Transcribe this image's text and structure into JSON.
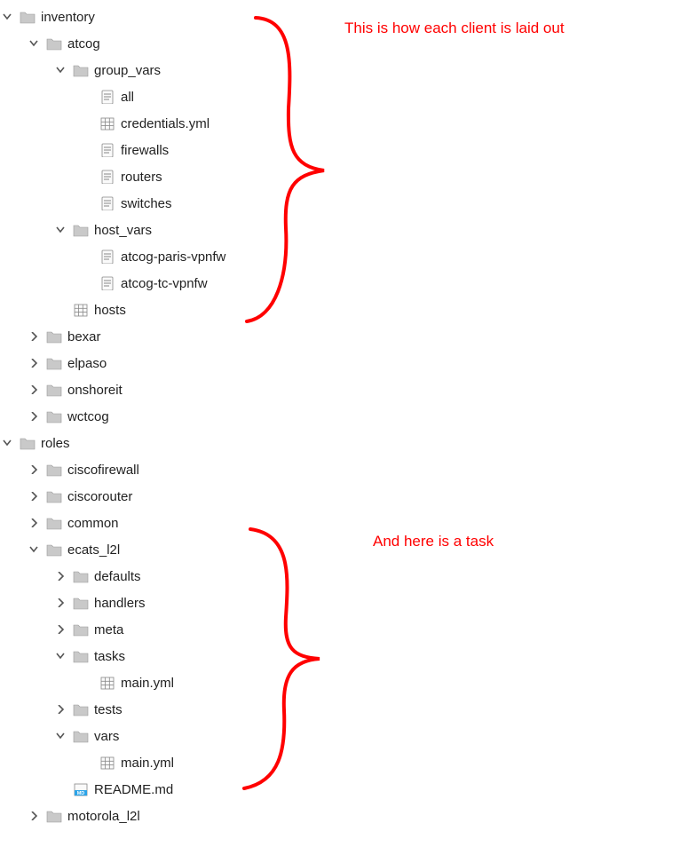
{
  "annotations": {
    "top": "This is how each client is laid out",
    "bottom": "And here is a task"
  },
  "tree": {
    "inventory": {
      "label": "inventory",
      "atcog": {
        "label": "atcog",
        "group_vars": {
          "label": "group_vars",
          "all": "all",
          "credentials": "credentials.yml",
          "firewalls": "firewalls",
          "routers": "routers",
          "switches": "switches"
        },
        "host_vars": {
          "label": "host_vars",
          "paris": "atcog-paris-vpnfw",
          "tc": "atcog-tc-vpnfw"
        },
        "hosts": "hosts"
      },
      "bexar": "bexar",
      "elpaso": "elpaso",
      "onshoreit": "onshoreit",
      "wctcog": "wctcog"
    },
    "roles": {
      "label": "roles",
      "ciscofirewall": "ciscofirewall",
      "ciscorouter": "ciscorouter",
      "common": "common",
      "ecats_l2l": {
        "label": "ecats_l2l",
        "defaults": "defaults",
        "handlers": "handlers",
        "meta": "meta",
        "tasks": {
          "label": "tasks",
          "main": "main.yml"
        },
        "tests": "tests",
        "vars": {
          "label": "vars",
          "main": "main.yml"
        },
        "readme": "README.md"
      },
      "motorola_l2l": "motorola_l2l"
    }
  }
}
